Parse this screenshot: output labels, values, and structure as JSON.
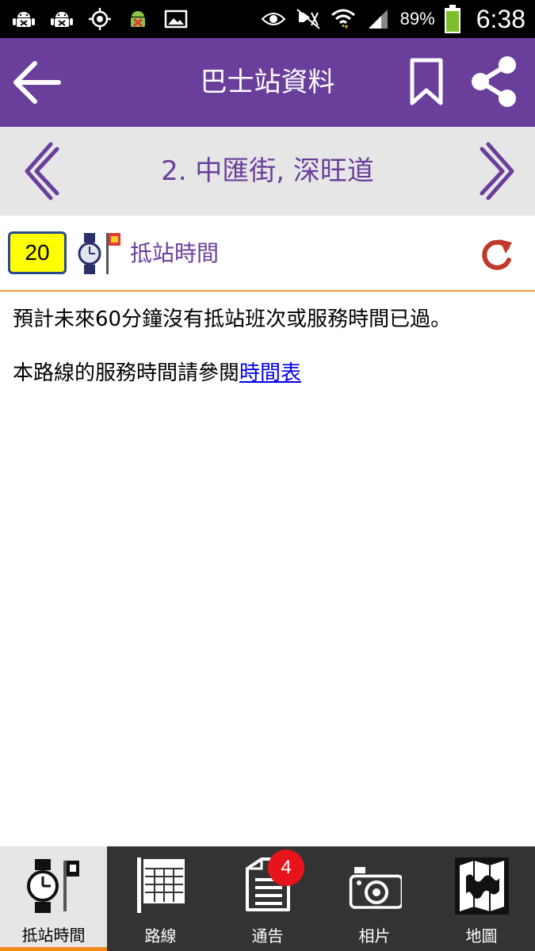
{
  "status_bar": {
    "battery_text": "89%",
    "time": "6:38",
    "left_icons": [
      "android-debug-icon",
      "android-debug-icon",
      "gps-icon",
      "android-error-icon",
      "image-icon"
    ],
    "right_icons": [
      "eye-icon",
      "mute-icon",
      "wifi-icon",
      "signal-icon",
      "battery-icon"
    ]
  },
  "app_bar": {
    "title": "巴士站資料",
    "back_icon": "arrow-left-icon",
    "actions": [
      "bookmark-icon",
      "share-icon"
    ]
  },
  "stop_nav": {
    "stop_name": "2. 中匯街, 深旺道"
  },
  "eta_header": {
    "route": "20",
    "label": "抵站時間"
  },
  "message": {
    "line1": "預計未來60分鐘沒有抵站班次或服務時間已過。",
    "line2_prefix": "本路線的服務時間請參閱",
    "line2_link": "時間表"
  },
  "bottom_nav": {
    "items": [
      {
        "label": "抵站時間",
        "icon": "watch-flag-icon",
        "active": true
      },
      {
        "label": "路線",
        "icon": "route-table-icon",
        "active": false
      },
      {
        "label": "通告",
        "icon": "notice-icon",
        "active": false
      },
      {
        "label": "相片",
        "icon": "camera-icon",
        "active": false
      },
      {
        "label": "地圖",
        "icon": "map-icon",
        "active": false
      }
    ],
    "notice_badge": "4"
  },
  "colors": {
    "primary": "#6a3f9c",
    "stop_bar": "#e6e6e6",
    "route_badge": "#ffff00",
    "accent": "#f28a1e",
    "refresh": "#c0392b",
    "badge": "#e8141b",
    "bottom_nav": "#333333"
  }
}
